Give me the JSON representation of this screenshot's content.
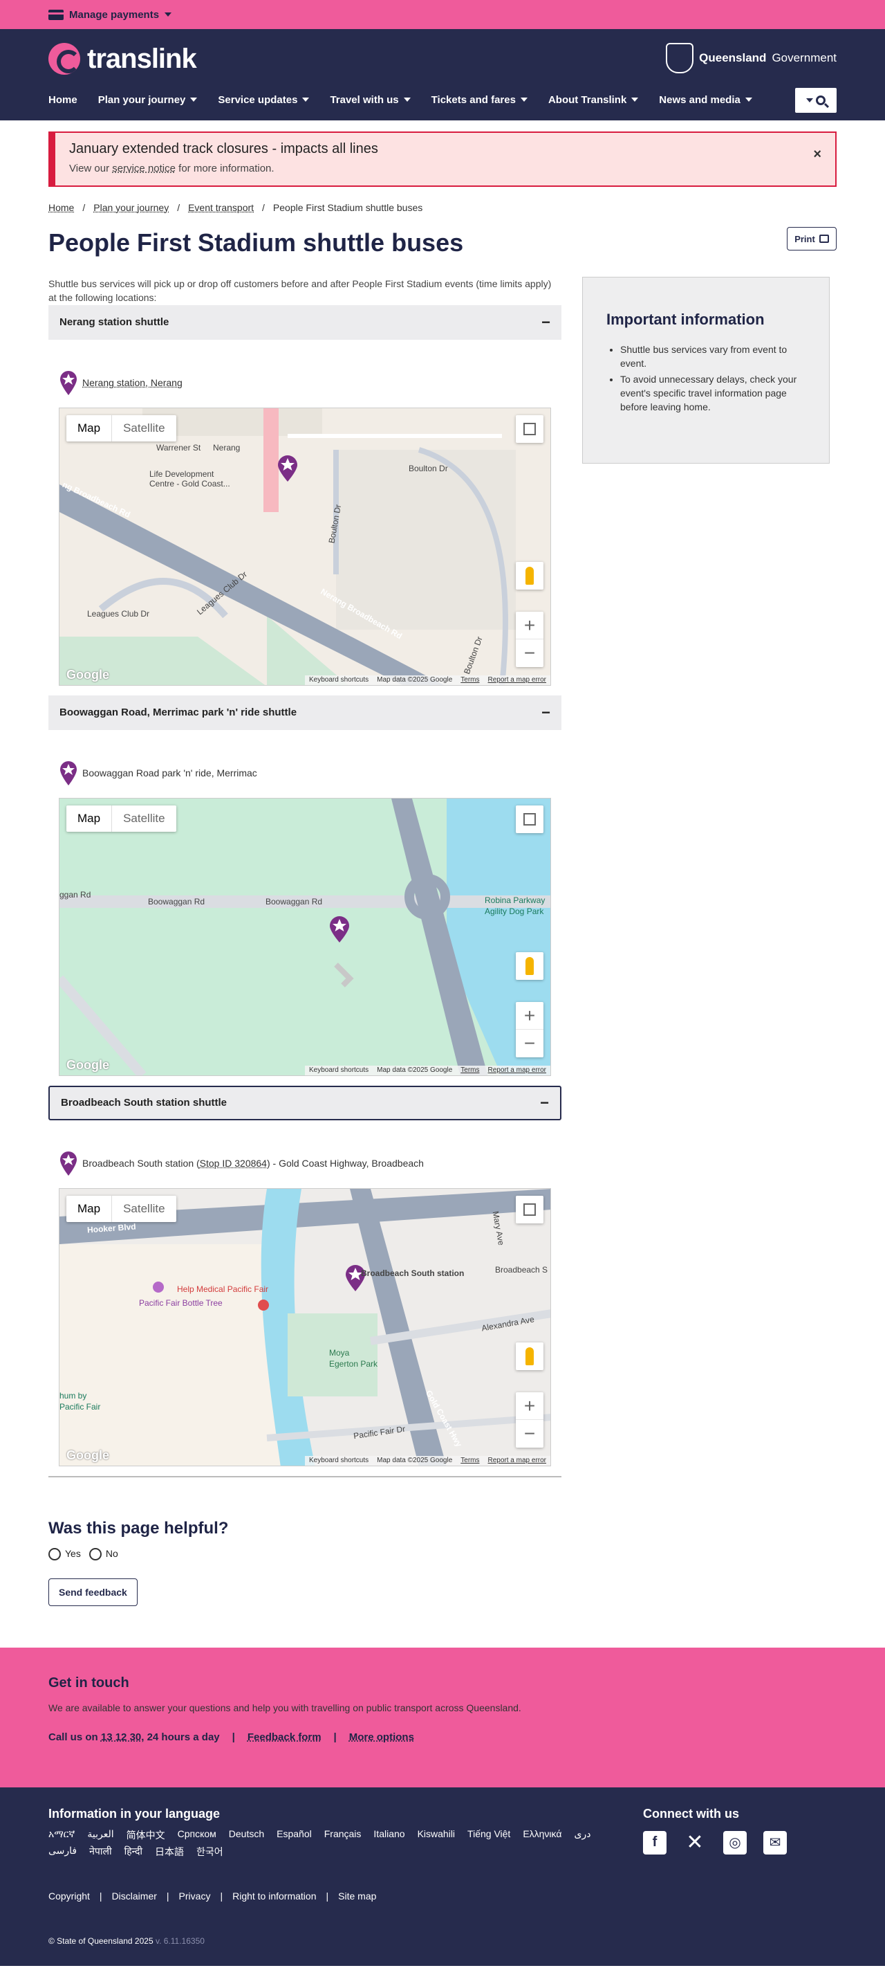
{
  "topbar": {
    "manage_payments": "Manage payments"
  },
  "header": {
    "logo_text": "translink",
    "qgov_bold": "Queensland",
    "qgov_text": "Government",
    "nav": [
      {
        "label": "Home",
        "caret": false
      },
      {
        "label": "Plan your journey",
        "caret": true
      },
      {
        "label": "Service updates",
        "caret": true
      },
      {
        "label": "Travel with us",
        "caret": true
      },
      {
        "label": "Tickets and fares",
        "caret": true
      },
      {
        "label": "About Translink",
        "caret": true
      },
      {
        "label": "News and media",
        "caret": true
      }
    ]
  },
  "alert": {
    "title": "January extended track closures - impacts all lines",
    "body_prefix": "View our",
    "body_link": "service notice",
    "body_suffix": "for more information.",
    "close": "×"
  },
  "breadcrumb": [
    "Home",
    "Plan your journey",
    "Event transport",
    "People First Stadium shuttle buses"
  ],
  "page": {
    "title": "People First Stadium shuttle buses",
    "print_label": "Print",
    "intro": "Shuttle bus services will pick up or drop off customers before and after People First Stadium events (time limits apply) at the following locations:"
  },
  "accordions": [
    {
      "heading": "Nerang station shuttle",
      "toggle": "−",
      "location_link": "Nerang station, Nerang",
      "location_text": "",
      "location_suffix": "",
      "map_labels": [
        "Warrener St",
        "Nerang",
        "Life Development Centre - Gold Coast...",
        "Boulton Dr",
        "Nerang Broadbeach Rd",
        "Leagues Club Dr",
        "Leagues Club Dr",
        "Boulton Dr",
        "Boulton Dr",
        "ng Broadbeach Rd"
      ]
    },
    {
      "heading": "Boowaggan Road, Merrimac park 'n' ride shuttle",
      "toggle": "−",
      "location_link": "",
      "location_text": "Boowaggan Road park 'n' ride, Merrimac",
      "location_suffix": "",
      "map_labels": [
        "Boowaggan Rd",
        "Boowaggan Rd",
        "ggan Rd",
        "Robina Parkway",
        "Agility Dog Park"
      ]
    },
    {
      "heading": "Broadbeach South station shuttle",
      "toggle": "−",
      "location_link": "Stop ID 320864",
      "location_text": "Broadbeach South station (",
      "location_suffix": ") - Gold Coast Highway, Broadbeach",
      "map_labels": [
        "Hooker Blvd",
        "Broadbeach South station",
        "Help Medical Pacific Fair",
        "Pacific Fair Bottle Tree",
        "Moya",
        "Egerton Park",
        "Alexandra Ave",
        "Mary Ave",
        "Broadbeach S",
        "Gold Coast Hwy",
        "Pacific Fair Dr",
        "hum by",
        "Pacific Fair"
      ]
    }
  ],
  "map_ui": {
    "map": "Map",
    "satellite": "Satellite",
    "zoom_in": "+",
    "zoom_out": "−",
    "google": "Google",
    "keyboard": "Keyboard shortcuts",
    "map_data": "Map data ©2025 Google",
    "terms": "Terms",
    "report": "Report a map error"
  },
  "sidebar": {
    "title": "Important information",
    "items": [
      "Shuttle bus services vary from event to event.",
      "To avoid unnecessary delays, check your event's specific travel information page before leaving home."
    ]
  },
  "feedback": {
    "title": "Was this page helpful?",
    "yes": "Yes",
    "no": "No",
    "button": "Send feedback"
  },
  "touch": {
    "title": "Get in touch",
    "body": "We are available to answer your questions and help you with travelling on public transport across Queensland.",
    "call_prefix": "Call us on",
    "phone": "13 12 30",
    "call_suffix": ", 24 hours a day",
    "feedback_form": "Feedback form",
    "more_options": "More options"
  },
  "footer": {
    "lang_title": "Information in your language",
    "languages": [
      "አማርኛ",
      "العربية",
      "简体中文",
      "Српском",
      "Deutsch",
      "Español",
      "Français",
      "Italiano",
      "Kiswahili",
      "Tiếng Việt",
      "Ελληνικά",
      "دری",
      "فارسی",
      "नेपाली",
      "हिन्दी",
      "日本語",
      "한국어"
    ],
    "connect_title": "Connect with us",
    "links": [
      "Copyright",
      "Disclaimer",
      "Privacy",
      "Right to information",
      "Site map"
    ],
    "copyright": "© State of Queensland 2025",
    "version": "v. 6.11.16350"
  },
  "colors": {
    "pink": "#ef5b9b",
    "navy": "#262b4d",
    "alert_red": "#d81c3f",
    "pin_purple": "#7b2e86"
  }
}
